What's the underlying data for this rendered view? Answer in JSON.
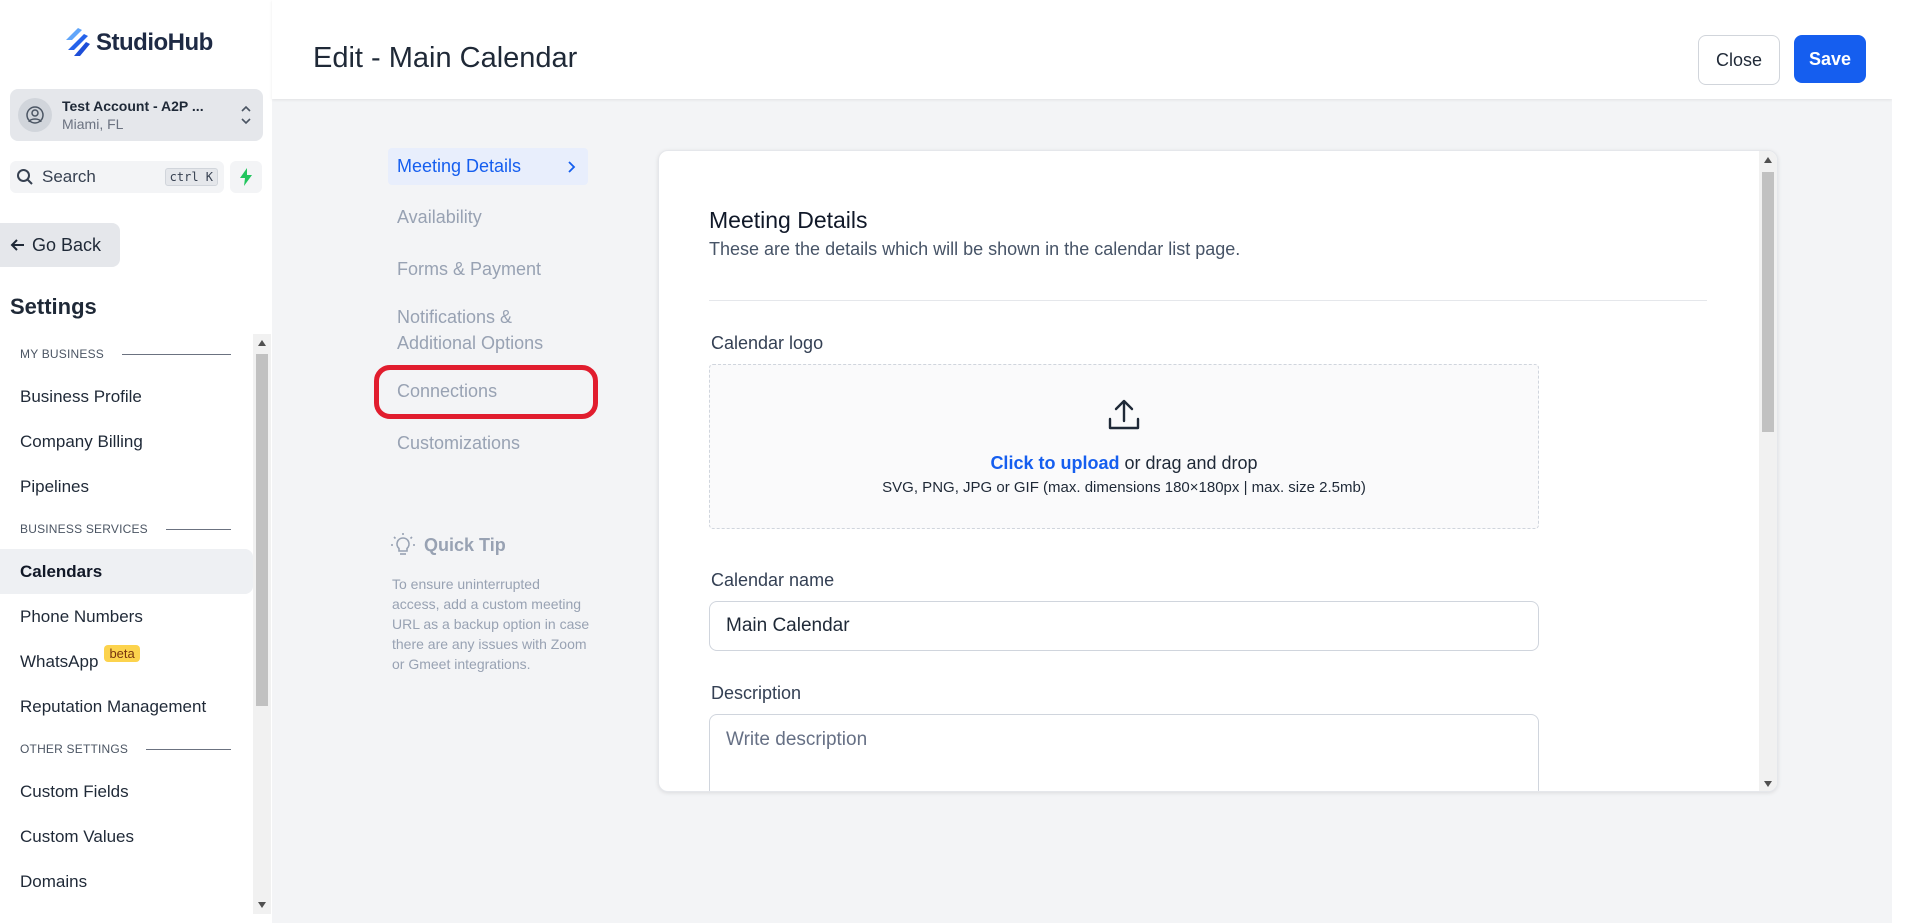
{
  "brand": {
    "name": "StudioHub"
  },
  "account": {
    "name": "Test Account - A2P ...",
    "location": "Miami, FL"
  },
  "search": {
    "label": "Search",
    "shortcut": "ctrl K"
  },
  "nav": {
    "go_back": "Go Back",
    "settings_title": "Settings",
    "sections": {
      "my_business": "MY BUSINESS",
      "business_services": "BUSINESS SERVICES",
      "other_settings": "OTHER SETTINGS"
    },
    "items": {
      "business_profile": "Business Profile",
      "company_billing": "Company Billing",
      "pipelines": "Pipelines",
      "calendars": "Calendars",
      "phone_numbers": "Phone Numbers",
      "whatsapp": "WhatsApp",
      "whatsapp_badge": "beta",
      "reputation": "Reputation Management",
      "custom_fields": "Custom Fields",
      "custom_values": "Custom Values",
      "domains": "Domains"
    }
  },
  "header": {
    "title": "Edit - Main Calendar",
    "close_label": "Close",
    "save_label": "Save"
  },
  "steps": {
    "meeting_details": "Meeting Details",
    "availability": "Availability",
    "forms_payment": "Forms & Payment",
    "notifications_line1": "Notifications &",
    "notifications_line2": "Additional Options",
    "connections": "Connections",
    "customizations": "Customizations"
  },
  "quick_tip": {
    "title": "Quick Tip",
    "body": "To ensure uninterrupted access, add a custom meeting URL as a backup option in case there are any issues with Zoom or Gmeet integrations."
  },
  "card": {
    "title": "Meeting Details",
    "subtitle": "These are the details which will be shown in the calendar list page.",
    "logo_label": "Calendar logo",
    "upload_link": "Click to upload",
    "upload_rest": " or drag and drop",
    "upload_hint": "SVG, PNG, JPG or GIF (max. dimensions 180×180px | max. size 2.5mb)",
    "name_label": "Calendar name",
    "name_value": "Main Calendar",
    "description_label": "Description",
    "description_placeholder": "Write description"
  },
  "colors": {
    "primary": "#155eef",
    "highlight": "#e11d2e",
    "badge": "#fcd34d"
  }
}
